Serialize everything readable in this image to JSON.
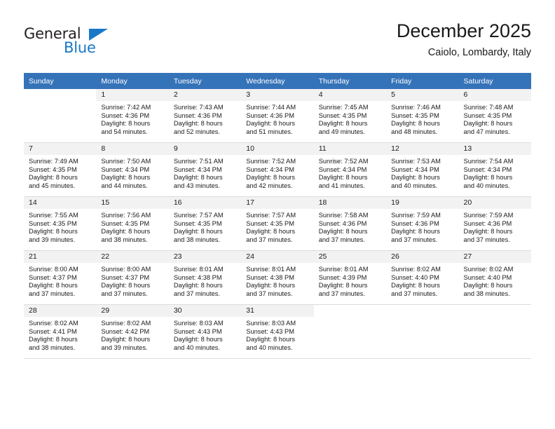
{
  "brand": {
    "logo_text_top": "General",
    "logo_text_bottom": "Blue",
    "logo_icon": "triangle-icon",
    "accent_color": "#1878c8"
  },
  "header": {
    "title": "December 2025",
    "subtitle": "Caiolo, Lombardy, Italy"
  },
  "calendar": {
    "header_bg": "#3573b9",
    "daynum_bg": "#f2f2f2",
    "weekdays": [
      "Sunday",
      "Monday",
      "Tuesday",
      "Wednesday",
      "Thursday",
      "Friday",
      "Saturday"
    ],
    "weeks": [
      [
        {
          "day": "",
          "sunrise": "",
          "sunset": "",
          "daylight_line1": "",
          "daylight_line2": ""
        },
        {
          "day": "1",
          "sunrise": "Sunrise: 7:42 AM",
          "sunset": "Sunset: 4:36 PM",
          "daylight_line1": "Daylight: 8 hours",
          "daylight_line2": "and 54 minutes."
        },
        {
          "day": "2",
          "sunrise": "Sunrise: 7:43 AM",
          "sunset": "Sunset: 4:36 PM",
          "daylight_line1": "Daylight: 8 hours",
          "daylight_line2": "and 52 minutes."
        },
        {
          "day": "3",
          "sunrise": "Sunrise: 7:44 AM",
          "sunset": "Sunset: 4:36 PM",
          "daylight_line1": "Daylight: 8 hours",
          "daylight_line2": "and 51 minutes."
        },
        {
          "day": "4",
          "sunrise": "Sunrise: 7:45 AM",
          "sunset": "Sunset: 4:35 PM",
          "daylight_line1": "Daylight: 8 hours",
          "daylight_line2": "and 49 minutes."
        },
        {
          "day": "5",
          "sunrise": "Sunrise: 7:46 AM",
          "sunset": "Sunset: 4:35 PM",
          "daylight_line1": "Daylight: 8 hours",
          "daylight_line2": "and 48 minutes."
        },
        {
          "day": "6",
          "sunrise": "Sunrise: 7:48 AM",
          "sunset": "Sunset: 4:35 PM",
          "daylight_line1": "Daylight: 8 hours",
          "daylight_line2": "and 47 minutes."
        }
      ],
      [
        {
          "day": "7",
          "sunrise": "Sunrise: 7:49 AM",
          "sunset": "Sunset: 4:35 PM",
          "daylight_line1": "Daylight: 8 hours",
          "daylight_line2": "and 45 minutes."
        },
        {
          "day": "8",
          "sunrise": "Sunrise: 7:50 AM",
          "sunset": "Sunset: 4:34 PM",
          "daylight_line1": "Daylight: 8 hours",
          "daylight_line2": "and 44 minutes."
        },
        {
          "day": "9",
          "sunrise": "Sunrise: 7:51 AM",
          "sunset": "Sunset: 4:34 PM",
          "daylight_line1": "Daylight: 8 hours",
          "daylight_line2": "and 43 minutes."
        },
        {
          "day": "10",
          "sunrise": "Sunrise: 7:52 AM",
          "sunset": "Sunset: 4:34 PM",
          "daylight_line1": "Daylight: 8 hours",
          "daylight_line2": "and 42 minutes."
        },
        {
          "day": "11",
          "sunrise": "Sunrise: 7:52 AM",
          "sunset": "Sunset: 4:34 PM",
          "daylight_line1": "Daylight: 8 hours",
          "daylight_line2": "and 41 minutes."
        },
        {
          "day": "12",
          "sunrise": "Sunrise: 7:53 AM",
          "sunset": "Sunset: 4:34 PM",
          "daylight_line1": "Daylight: 8 hours",
          "daylight_line2": "and 40 minutes."
        },
        {
          "day": "13",
          "sunrise": "Sunrise: 7:54 AM",
          "sunset": "Sunset: 4:34 PM",
          "daylight_line1": "Daylight: 8 hours",
          "daylight_line2": "and 40 minutes."
        }
      ],
      [
        {
          "day": "14",
          "sunrise": "Sunrise: 7:55 AM",
          "sunset": "Sunset: 4:35 PM",
          "daylight_line1": "Daylight: 8 hours",
          "daylight_line2": "and 39 minutes."
        },
        {
          "day": "15",
          "sunrise": "Sunrise: 7:56 AM",
          "sunset": "Sunset: 4:35 PM",
          "daylight_line1": "Daylight: 8 hours",
          "daylight_line2": "and 38 minutes."
        },
        {
          "day": "16",
          "sunrise": "Sunrise: 7:57 AM",
          "sunset": "Sunset: 4:35 PM",
          "daylight_line1": "Daylight: 8 hours",
          "daylight_line2": "and 38 minutes."
        },
        {
          "day": "17",
          "sunrise": "Sunrise: 7:57 AM",
          "sunset": "Sunset: 4:35 PM",
          "daylight_line1": "Daylight: 8 hours",
          "daylight_line2": "and 37 minutes."
        },
        {
          "day": "18",
          "sunrise": "Sunrise: 7:58 AM",
          "sunset": "Sunset: 4:36 PM",
          "daylight_line1": "Daylight: 8 hours",
          "daylight_line2": "and 37 minutes."
        },
        {
          "day": "19",
          "sunrise": "Sunrise: 7:59 AM",
          "sunset": "Sunset: 4:36 PM",
          "daylight_line1": "Daylight: 8 hours",
          "daylight_line2": "and 37 minutes."
        },
        {
          "day": "20",
          "sunrise": "Sunrise: 7:59 AM",
          "sunset": "Sunset: 4:36 PM",
          "daylight_line1": "Daylight: 8 hours",
          "daylight_line2": "and 37 minutes."
        }
      ],
      [
        {
          "day": "21",
          "sunrise": "Sunrise: 8:00 AM",
          "sunset": "Sunset: 4:37 PM",
          "daylight_line1": "Daylight: 8 hours",
          "daylight_line2": "and 37 minutes."
        },
        {
          "day": "22",
          "sunrise": "Sunrise: 8:00 AM",
          "sunset": "Sunset: 4:37 PM",
          "daylight_line1": "Daylight: 8 hours",
          "daylight_line2": "and 37 minutes."
        },
        {
          "day": "23",
          "sunrise": "Sunrise: 8:01 AM",
          "sunset": "Sunset: 4:38 PM",
          "daylight_line1": "Daylight: 8 hours",
          "daylight_line2": "and 37 minutes."
        },
        {
          "day": "24",
          "sunrise": "Sunrise: 8:01 AM",
          "sunset": "Sunset: 4:38 PM",
          "daylight_line1": "Daylight: 8 hours",
          "daylight_line2": "and 37 minutes."
        },
        {
          "day": "25",
          "sunrise": "Sunrise: 8:01 AM",
          "sunset": "Sunset: 4:39 PM",
          "daylight_line1": "Daylight: 8 hours",
          "daylight_line2": "and 37 minutes."
        },
        {
          "day": "26",
          "sunrise": "Sunrise: 8:02 AM",
          "sunset": "Sunset: 4:40 PM",
          "daylight_line1": "Daylight: 8 hours",
          "daylight_line2": "and 37 minutes."
        },
        {
          "day": "27",
          "sunrise": "Sunrise: 8:02 AM",
          "sunset": "Sunset: 4:40 PM",
          "daylight_line1": "Daylight: 8 hours",
          "daylight_line2": "and 38 minutes."
        }
      ],
      [
        {
          "day": "28",
          "sunrise": "Sunrise: 8:02 AM",
          "sunset": "Sunset: 4:41 PM",
          "daylight_line1": "Daylight: 8 hours",
          "daylight_line2": "and 38 minutes."
        },
        {
          "day": "29",
          "sunrise": "Sunrise: 8:02 AM",
          "sunset": "Sunset: 4:42 PM",
          "daylight_line1": "Daylight: 8 hours",
          "daylight_line2": "and 39 minutes."
        },
        {
          "day": "30",
          "sunrise": "Sunrise: 8:03 AM",
          "sunset": "Sunset: 4:43 PM",
          "daylight_line1": "Daylight: 8 hours",
          "daylight_line2": "and 40 minutes."
        },
        {
          "day": "31",
          "sunrise": "Sunrise: 8:03 AM",
          "sunset": "Sunset: 4:43 PM",
          "daylight_line1": "Daylight: 8 hours",
          "daylight_line2": "and 40 minutes."
        },
        {
          "day": "",
          "sunrise": "",
          "sunset": "",
          "daylight_line1": "",
          "daylight_line2": ""
        },
        {
          "day": "",
          "sunrise": "",
          "sunset": "",
          "daylight_line1": "",
          "daylight_line2": ""
        },
        {
          "day": "",
          "sunrise": "",
          "sunset": "",
          "daylight_line1": "",
          "daylight_line2": ""
        }
      ]
    ]
  }
}
